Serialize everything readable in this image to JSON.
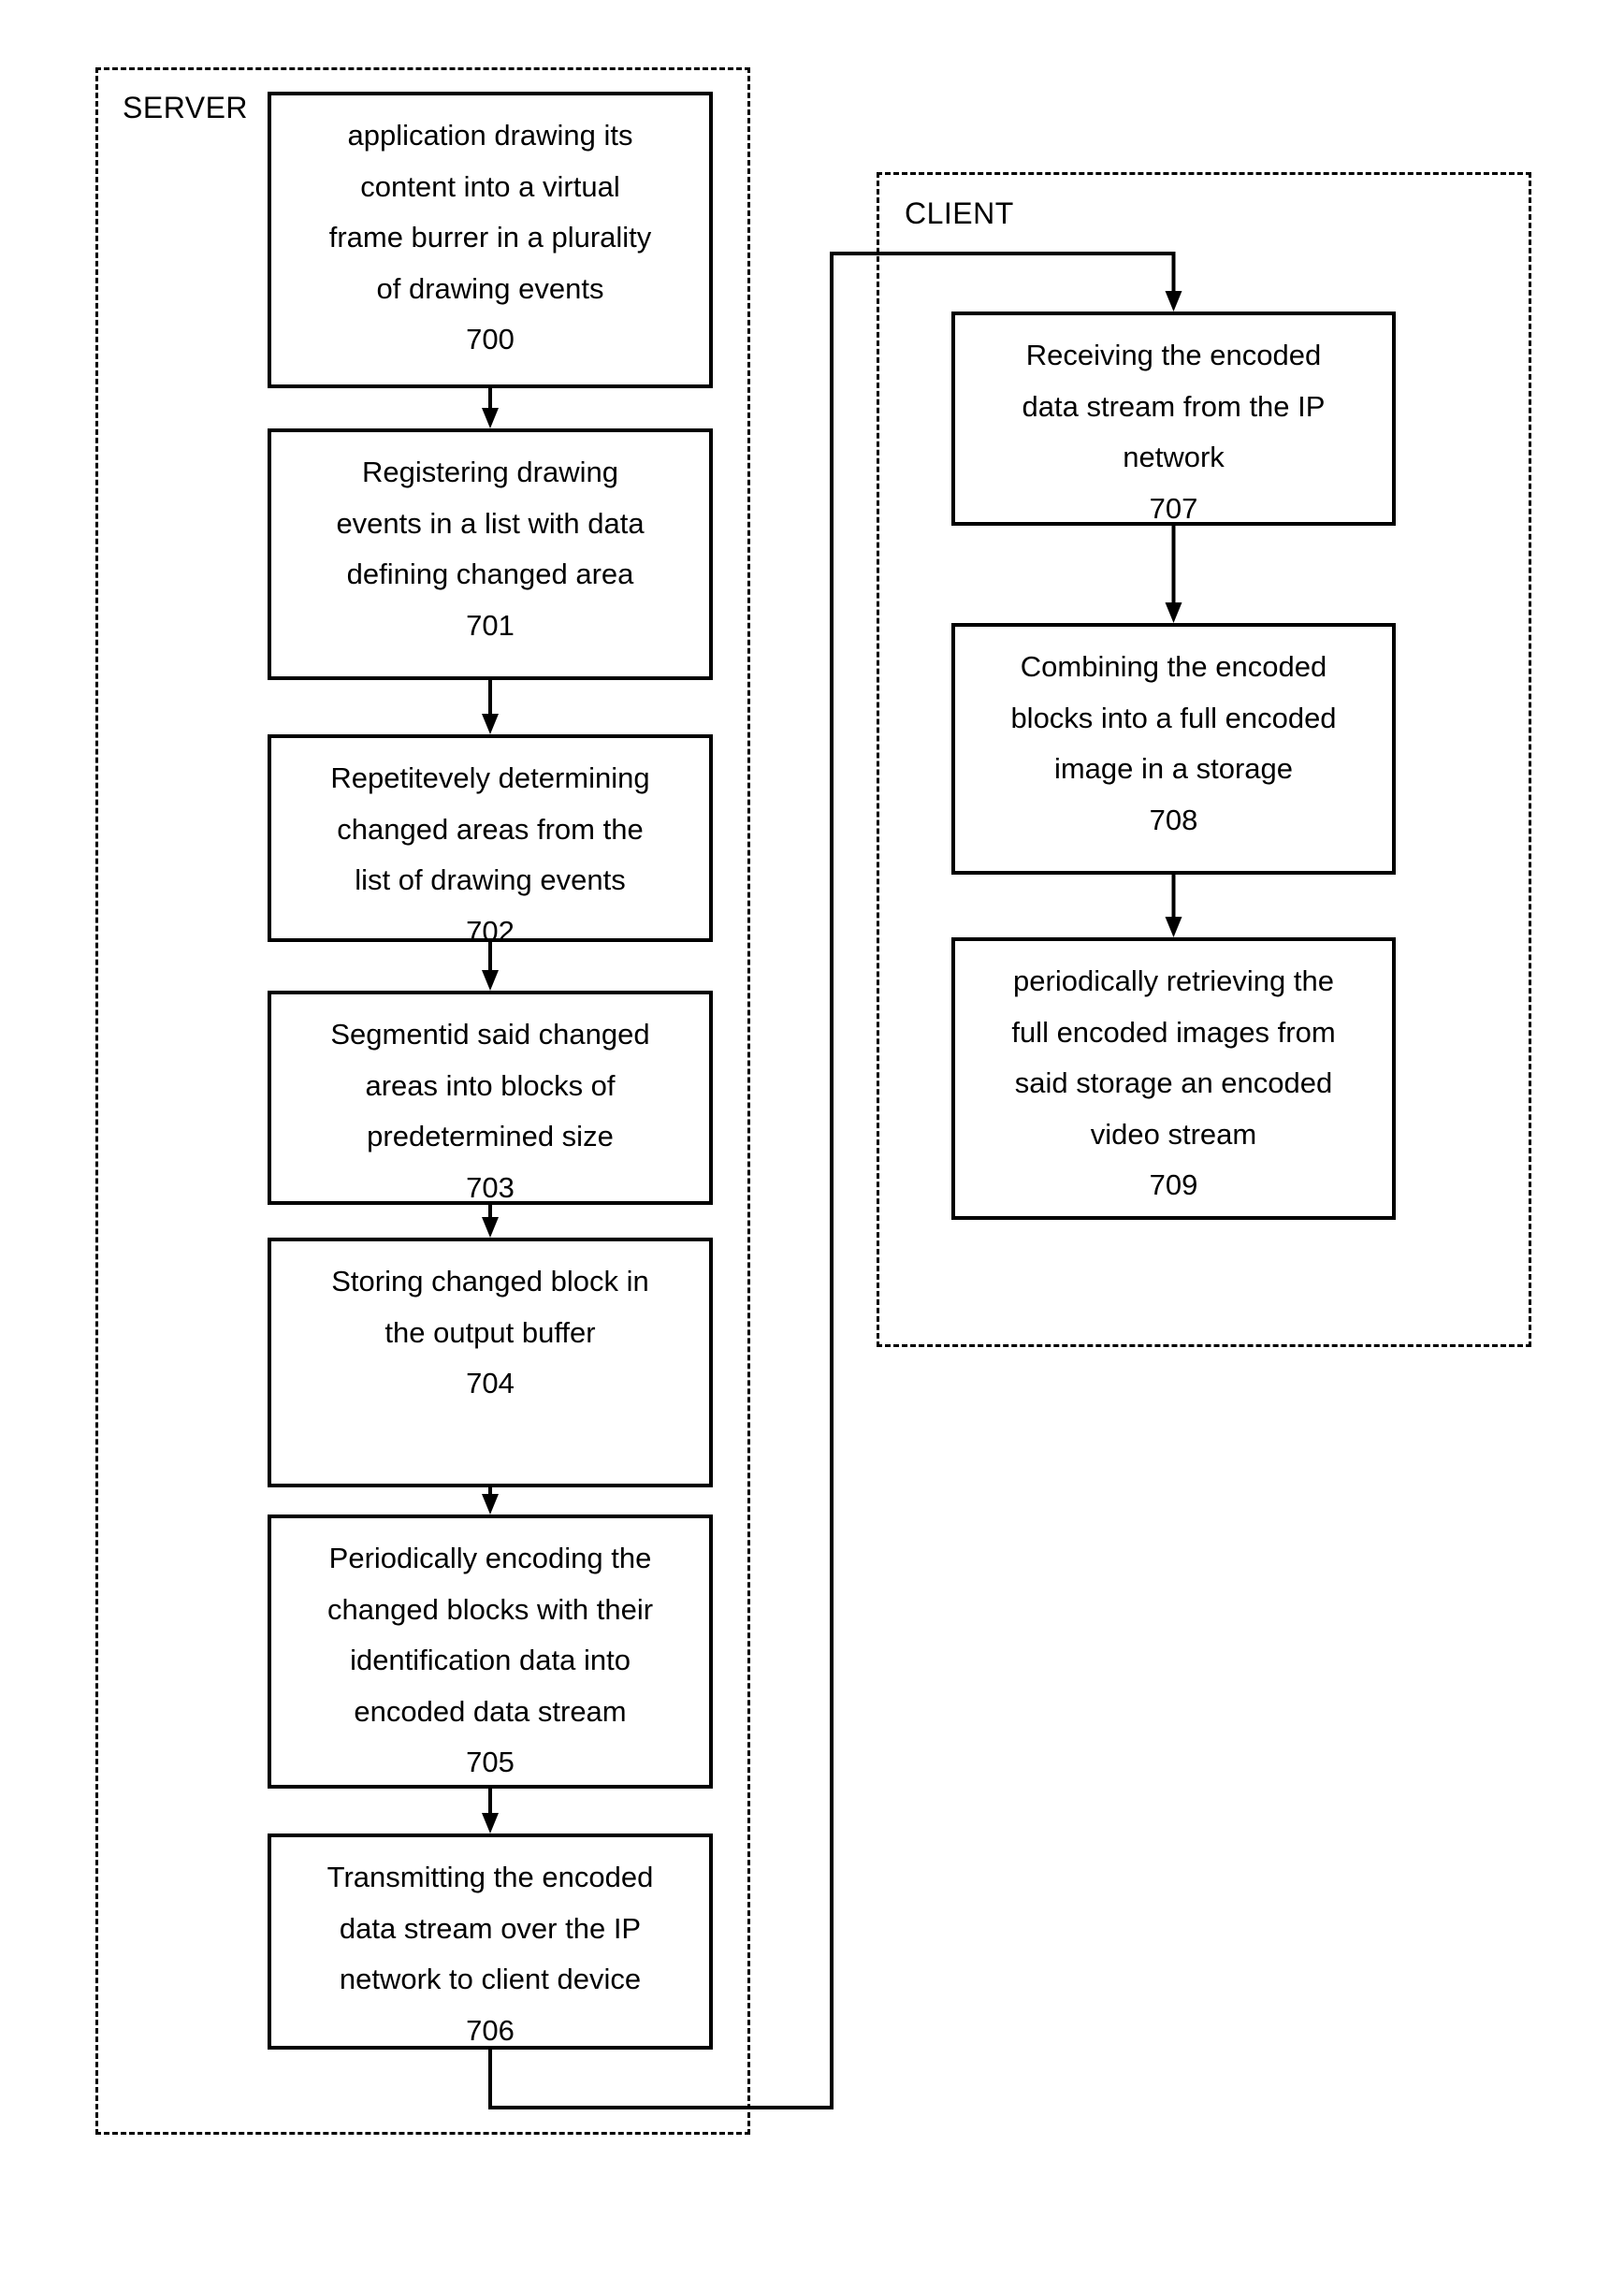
{
  "figure": {
    "groups": [
      {
        "id": "server",
        "label": "SERVER"
      },
      {
        "id": "client",
        "label": "CLIENT"
      }
    ],
    "steps": [
      {
        "id": "700",
        "group": "server",
        "lines": [
          "application drawing its",
          "content into a virtual",
          "frame burrer in a plurality",
          "of drawing events"
        ],
        "ref": "700"
      },
      {
        "id": "701",
        "group": "server",
        "lines": [
          "Registering drawing",
          "events in a list with data",
          "defining changed area"
        ],
        "ref": "701"
      },
      {
        "id": "702",
        "group": "server",
        "lines": [
          "Repetitevely determining",
          "changed areas from the",
          "list of drawing events"
        ],
        "ref": "702"
      },
      {
        "id": "703",
        "group": "server",
        "lines": [
          "Segmentid said changed",
          "areas into blocks of",
          "predetermined size"
        ],
        "ref": "703"
      },
      {
        "id": "704",
        "group": "server",
        "lines": [
          "Storing changed block in",
          "the output buffer"
        ],
        "ref": "704"
      },
      {
        "id": "705",
        "group": "server",
        "lines": [
          "Periodically encoding the",
          "changed blocks with their",
          "identification data into",
          "encoded data stream"
        ],
        "ref": "705"
      },
      {
        "id": "706",
        "group": "server",
        "lines": [
          "Transmitting the encoded",
          "data stream over the IP",
          "network to client device"
        ],
        "ref": "706"
      },
      {
        "id": "707",
        "group": "client",
        "lines": [
          "Receiving the encoded",
          "data stream from the IP",
          "network"
        ],
        "ref": "707"
      },
      {
        "id": "708",
        "group": "client",
        "lines": [
          "Combining the encoded",
          "blocks into a full encoded",
          "image in a storage"
        ],
        "ref": "708"
      },
      {
        "id": "709",
        "group": "client",
        "lines": [
          "periodically retrieving the",
          "full encoded images from",
          "said storage an encoded",
          "video stream"
        ],
        "ref": "709"
      }
    ],
    "flow": [
      [
        "700",
        "701"
      ],
      [
        "701",
        "702"
      ],
      [
        "702",
        "703"
      ],
      [
        "703",
        "704"
      ],
      [
        "704",
        "705"
      ],
      [
        "705",
        "706"
      ],
      [
        "706",
        "707"
      ],
      [
        "707",
        "708"
      ],
      [
        "708",
        "709"
      ]
    ]
  }
}
